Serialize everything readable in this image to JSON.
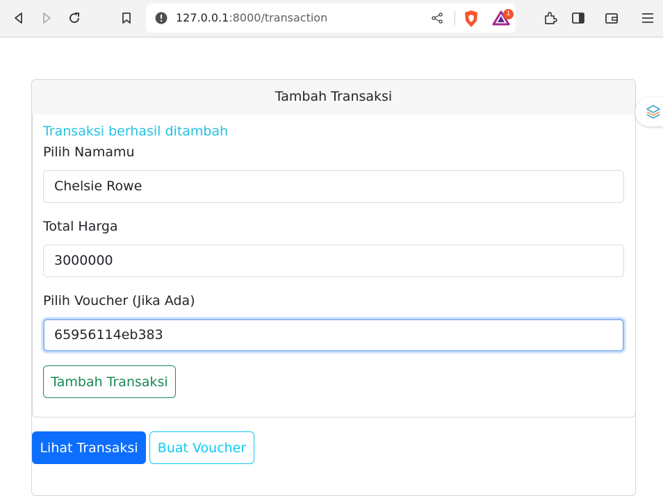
{
  "browser": {
    "url_host": "127.0.0.1",
    "url_path": ":8000/transaction",
    "notification_count": "1"
  },
  "page": {
    "card_title": "Tambah Transaksi",
    "success_message": "Transaksi berhasil ditambah",
    "name_label": "Pilih Namamu",
    "name_value": "Chelsie Rowe",
    "total_label": "Total Harga",
    "total_value": "3000000",
    "voucher_label": "Pilih Voucher (Jika Ada)",
    "voucher_value": "65956114eb383",
    "submit_label": "Tambah Transaksi",
    "view_transactions_label": "Lihat Transaksi",
    "create_voucher_label": "Buat Voucher"
  },
  "colors": {
    "primary": "#0d6efd",
    "success": "#198754",
    "info": "#0dcaf0"
  },
  "icons": [
    "back-icon",
    "forward-icon",
    "reload-icon",
    "bookmark-icon",
    "info-icon",
    "share-icon",
    "brave-shield-icon",
    "brave-rewards-icon",
    "extensions-icon",
    "sidebar-icon",
    "wallet-icon",
    "menu-icon",
    "extension-float-icon"
  ]
}
